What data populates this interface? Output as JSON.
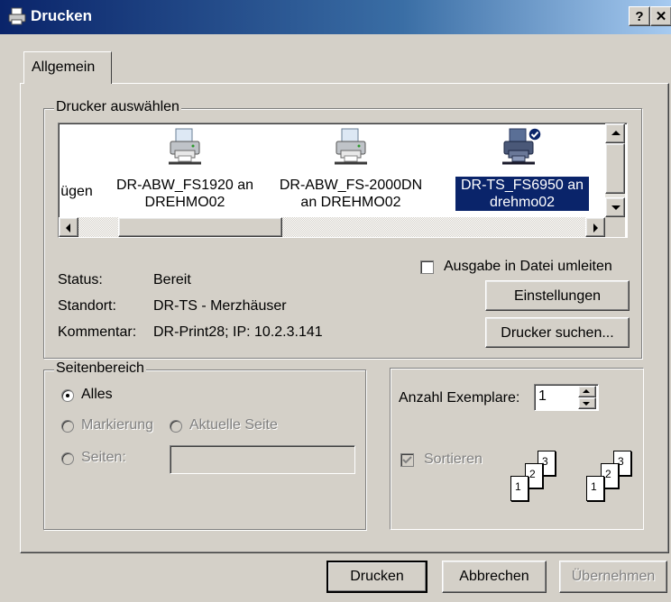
{
  "window": {
    "title": "Drucken",
    "help_btn": "?",
    "close_btn": "✕"
  },
  "tabs": [
    {
      "label": "Allgemein"
    }
  ],
  "printer_group": {
    "legend": "Drucker auswählen",
    "printers": [
      {
        "name": "ügen",
        "line2": ""
      },
      {
        "name": "DR-ABW_FS1920 an",
        "line2": "DREHMO02"
      },
      {
        "name": "DR-ABW_FS-2000DN",
        "line2": "an DREHMO02"
      },
      {
        "name": "DR-TS_FS6950 an",
        "line2": "drehmo02",
        "selected": true
      }
    ],
    "status_label": "Status:",
    "status_value": "Bereit",
    "location_label": "Standort:",
    "location_value": "DR-TS - Merzhäuser",
    "comment_label": "Kommentar:",
    "comment_value": "DR-Print28; IP: 10.2.3.141",
    "print_to_file": "Ausgabe in Datei umleiten",
    "settings_btn": "Einstellungen",
    "find_printer_btn": "Drucker suchen..."
  },
  "range_group": {
    "legend": "Seitenbereich",
    "all": "Alles",
    "selection": "Markierung",
    "current_page": "Aktuelle Seite",
    "pages": "Seiten:"
  },
  "copies": {
    "label": "Anzahl Exemplare:",
    "value": "1",
    "collate": "Sortieren",
    "page_numbers": [
      "1",
      "2",
      "3"
    ]
  },
  "footer": {
    "print_btn": "Drucken",
    "cancel_btn": "Abbrechen",
    "apply_btn": "Übernehmen"
  },
  "colors": {
    "titlebar": "#0a246a",
    "selection": "#0a246a",
    "face": "#d4d0c8"
  }
}
